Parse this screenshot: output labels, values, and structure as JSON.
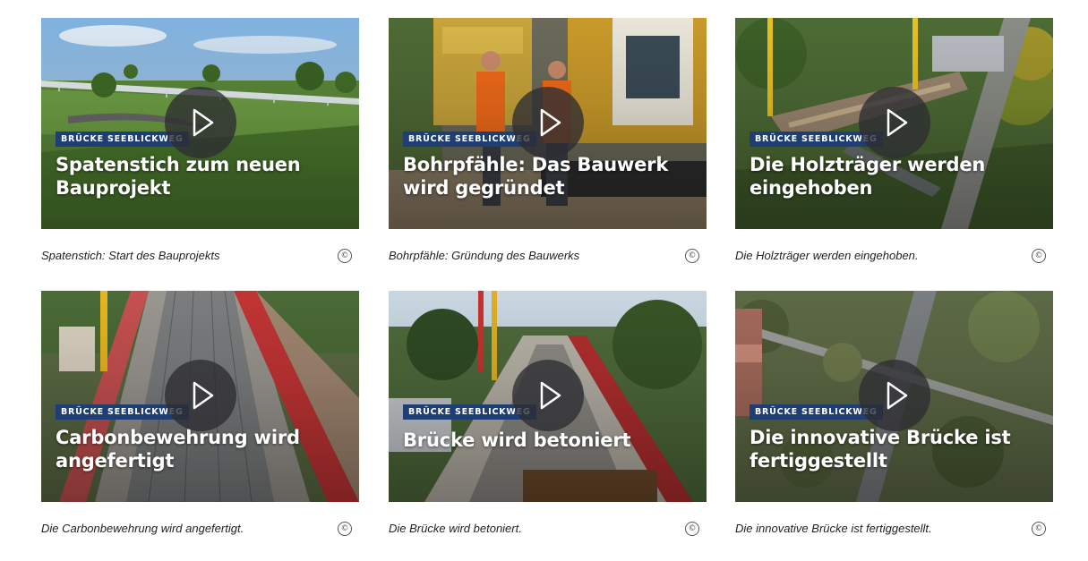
{
  "cards": [
    {
      "badge": "BRÜCKE SEEBLICKWEG",
      "title": "Spatenstich zum neuen Bauprojekt",
      "caption": "Spatenstich: Start des Bauprojekts",
      "copyright": "©",
      "scene": "rendering-bridge"
    },
    {
      "badge": "BRÜCKE SEEBLICKWEG",
      "title": "Bohrpfähle: Das Bauwerk wird gegründet",
      "caption": "Bohrpfähle: Gründung des Bauwerks",
      "copyright": "©",
      "scene": "drilling-workers"
    },
    {
      "badge": "BRÜCKE SEEBLICKWEG",
      "title": "Die Holzträger werden eingehoben",
      "caption": "Die Holzträger werden eingehoben.",
      "copyright": "©",
      "scene": "aerial-crane"
    },
    {
      "badge": "BRÜCKE SEEBLICKWEG",
      "title": "Carbonbewehrung wird angefertigt",
      "caption": "Die Carbonbewehrung wird angefertigt.",
      "copyright": "©",
      "scene": "carbon-reinforcement"
    },
    {
      "badge": "BRÜCKE SEEBLICKWEG",
      "title": "Brücke wird betoniert",
      "caption": "Die Brücke wird betoniert.",
      "copyright": "©",
      "scene": "concrete-pour"
    },
    {
      "badge": "BRÜCKE SEEBLICKWEG",
      "title": "Die innovative Brücke ist fertiggestellt",
      "caption": "Die innovative Brücke ist fertiggestellt.",
      "copyright": "©",
      "scene": "aerial-finished"
    }
  ],
  "icons": {
    "play": "play-icon",
    "copyright": "copyright-icon"
  },
  "colors": {
    "badge": "#1f3e73",
    "play_bg": "#2d2d32",
    "text": "#222222"
  }
}
